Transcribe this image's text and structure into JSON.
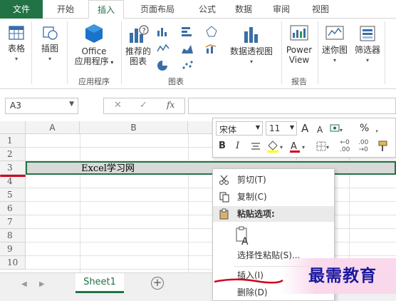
{
  "ribbon_tabs": [
    "文件",
    "开始",
    "插入",
    "页面布局",
    "公式",
    "数据",
    "审阅",
    "视图"
  ],
  "active_tab": "插入",
  "ribbon": {
    "table_label": "表格",
    "illustration_label": "插图",
    "office_apps_line1": "Office",
    "office_apps_line2": "应用程序",
    "group_apps": "应用程序",
    "recommended_charts_line1": "推荐的",
    "recommended_charts_line2": "图表",
    "pivot_chart_label": "数据透视图",
    "group_charts": "图表",
    "power_view_line1": "Power",
    "power_view_line2": "View",
    "group_reports": "报告",
    "sparklines_label": "迷你图",
    "filters_label": "筛选器"
  },
  "formula_bar": {
    "name_box": "A3",
    "cancel_glyph": "✕",
    "enter_glyph": "✓",
    "fx_glyph": "fx"
  },
  "grid": {
    "columns": [
      "A",
      "B"
    ],
    "rows": [
      "1",
      "2",
      "3",
      "4",
      "5",
      "6",
      "7",
      "8",
      "9",
      "10"
    ],
    "cell_b3": "Excel学习网"
  },
  "mini_toolbar": {
    "font_name": "宋体",
    "font_size": "11",
    "grow_font": "A",
    "shrink_font": "A",
    "percent": "%",
    "bold": "B",
    "italic": "I"
  },
  "context_menu": {
    "cut": "剪切(T)",
    "copy": "复制(C)",
    "paste_options": "粘贴选项:",
    "paste_special": "选择性粘贴(S)...",
    "insert": "插入(I)",
    "delete": "删除(D)"
  },
  "sheet_tabs": [
    "Sheet1"
  ],
  "watermark": "最需教育",
  "colors": {
    "excel_green": "#217346",
    "selection_outline": "#217346",
    "annotation_red": "#d0021b",
    "watermark_text": "#1a1aa0"
  }
}
